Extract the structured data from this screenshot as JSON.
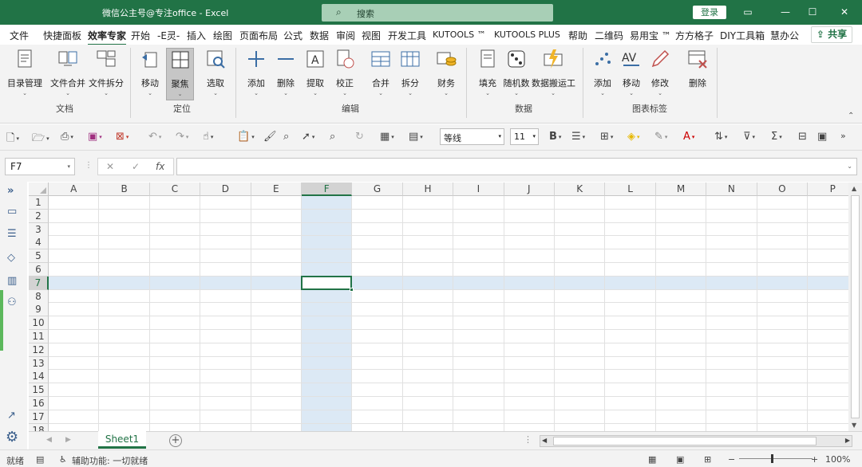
{
  "window": {
    "title": "微信公主号@专注office  -  Excel",
    "search_placeholder": "搜索",
    "login": "登录",
    "minimize_glyph": "—",
    "maximize_glyph": "☐",
    "close_glyph": "✕",
    "ribbon_toggle_glyph": "▭"
  },
  "menu": {
    "tabs": [
      "文件",
      "快捷面板",
      "效率专家",
      "开始",
      "-E灵-",
      "插入",
      "绘图",
      "页面布局",
      "公式",
      "数据",
      "审阅",
      "视图",
      "开发工具",
      "KUTOOLS ™",
      "KUTOOLS PLUS",
      "帮助",
      "二维码",
      "易用宝 ™",
      "方方格子",
      "DIY工具箱",
      "慧办公"
    ],
    "active_tab": "效率专家",
    "share": "共享"
  },
  "ribbon": {
    "buttons": [
      "目录管理",
      "文件合并",
      "文件拆分",
      "移动",
      "聚焦",
      "选取",
      "添加",
      "删除",
      "提取",
      "校正",
      "合并",
      "拆分",
      "财务",
      "填充",
      "随机数",
      "数据搬运工",
      "添加",
      "移动",
      "修改",
      "删除"
    ],
    "groups": [
      "文档",
      "定位",
      "编辑",
      "数据",
      "图表标签"
    ]
  },
  "quick_toolbar": {
    "font_name": "等线",
    "font_size": "11",
    "bold_label": "B"
  },
  "formula_bar": {
    "name_box": "F7",
    "cancel_glyph": "✕",
    "enter_glyph": "✓",
    "fx_label": "fx",
    "value": ""
  },
  "grid": {
    "columns": [
      "A",
      "B",
      "C",
      "D",
      "E",
      "F",
      "G",
      "H",
      "I",
      "J",
      "K",
      "L",
      "M",
      "N",
      "O",
      "P"
    ],
    "rows": [
      "1",
      "2",
      "3",
      "4",
      "5",
      "6",
      "7",
      "8",
      "9",
      "10",
      "11",
      "12",
      "13",
      "14",
      "15",
      "16",
      "17",
      "18"
    ],
    "selected_column": "F",
    "selected_row": "7"
  },
  "sheets": {
    "tabs": [
      "Sheet1"
    ],
    "active": "Sheet1"
  },
  "status": {
    "ready": "就绪",
    "accessibility": "辅助功能: 一切就绪",
    "zoom": "100%"
  },
  "colors": {
    "accent": "#217346",
    "focus_fill": "#dce9f5"
  }
}
